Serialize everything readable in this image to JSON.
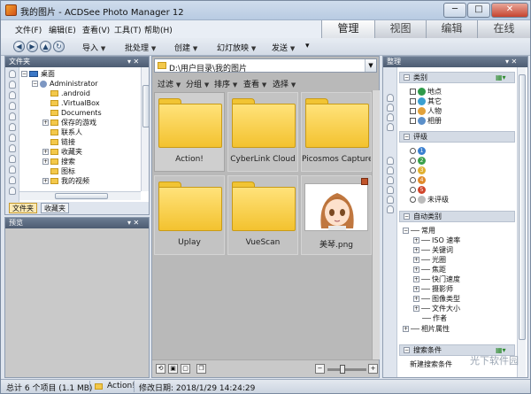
{
  "window": {
    "title": "我的图片 - ACDSee Photo Manager 12",
    "min": "─",
    "max": "□",
    "close": "✕"
  },
  "menu": {
    "items": [
      "文件(F)",
      "编辑(E)",
      "查看(V)",
      "工具(T)",
      "帮助(H)"
    ]
  },
  "mode_tabs": [
    "管理",
    "视图",
    "编辑",
    "在线"
  ],
  "toolbar": {
    "items": [
      "导入",
      "批处理",
      "创建",
      "幻灯放映",
      "发送"
    ],
    "more": "▾"
  },
  "folders_panel": {
    "title": "文件夹",
    "pin": "▾ ✕",
    "tree": [
      "桌面",
      "Administrator",
      ".android",
      ".VirtualBox",
      "Documents",
      "保存的游戏",
      "联系人",
      "链接",
      "收藏夹",
      "搜索",
      "图标",
      "我的视频"
    ],
    "tabs": [
      "文件夹",
      "收藏夹"
    ]
  },
  "preview_panel": {
    "title": "预览"
  },
  "browser": {
    "path": "D:\\用户目录\\我的图片",
    "tools": [
      "过滤",
      "分组",
      "排序",
      "查看",
      "选择"
    ],
    "items": [
      {
        "label": "Action!",
        "type": "folder"
      },
      {
        "label": "CyberLink Cloud",
        "type": "folder"
      },
      {
        "label": "Picosmos Capture",
        "type": "folder"
      },
      {
        "label": "Uplay",
        "type": "folder"
      },
      {
        "label": "VueScan",
        "type": "folder"
      },
      {
        "label": "美琴.png",
        "type": "image"
      }
    ]
  },
  "organize_panel": {
    "title": "整理",
    "sections": {
      "category": {
        "title": "类别",
        "items": [
          "地点",
          "其它",
          "人物",
          "相册"
        ]
      },
      "rating": {
        "title": "评级",
        "items": [
          "1",
          "2",
          "3",
          "4",
          "5",
          "未评级"
        ]
      },
      "auto": {
        "title": "自动类别",
        "root": "常用",
        "items": [
          "ISO 速率",
          "关键词",
          "光圈",
          "焦距",
          "快门速度",
          "摄影师",
          "图像类型",
          "文件大小",
          "作者"
        ],
        "footer": "相片属性"
      },
      "search": {
        "title": "搜索条件",
        "new": "新建搜索条件"
      }
    }
  },
  "status": {
    "total": "总计 6 个项目 (1.1 MB)",
    "selected": "Action!",
    "modified": "修改日期: 2018/1/29 14:24:29"
  },
  "watermark": "光下软件园"
}
